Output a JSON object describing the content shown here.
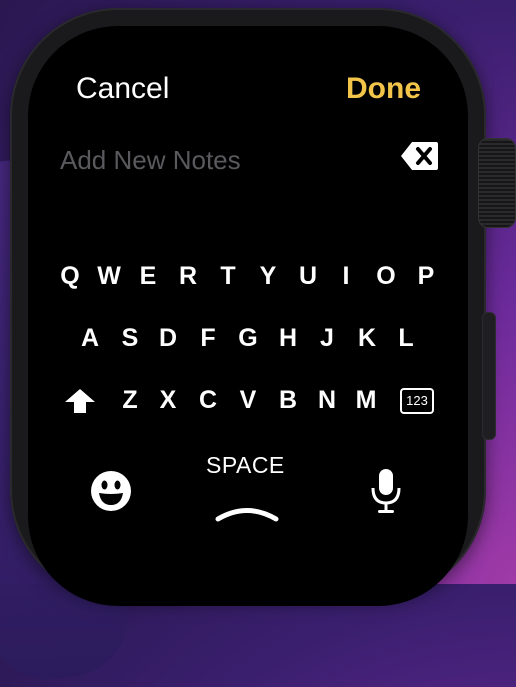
{
  "header": {
    "cancel_label": "Cancel",
    "done_label": "Done"
  },
  "note_input": {
    "placeholder": "Add New Notes",
    "value": ""
  },
  "keyboard": {
    "row1": [
      "Q",
      "W",
      "E",
      "R",
      "T",
      "Y",
      "U",
      "I",
      "O",
      "P"
    ],
    "row2": [
      "A",
      "S",
      "D",
      "F",
      "G",
      "H",
      "J",
      "K",
      "L"
    ],
    "row3": [
      "Z",
      "X",
      "C",
      "V",
      "B",
      "N",
      "M"
    ],
    "numbers_label": "123",
    "space_label": "SPACE"
  },
  "colors": {
    "accent": "#f2c44a",
    "placeholder": "#5a5a5e"
  },
  "icons": [
    "delete-backspace-icon",
    "shift-arrow-icon",
    "numbers-key-icon",
    "emoji-icon",
    "microphone-icon",
    "chevron-up-icon"
  ]
}
